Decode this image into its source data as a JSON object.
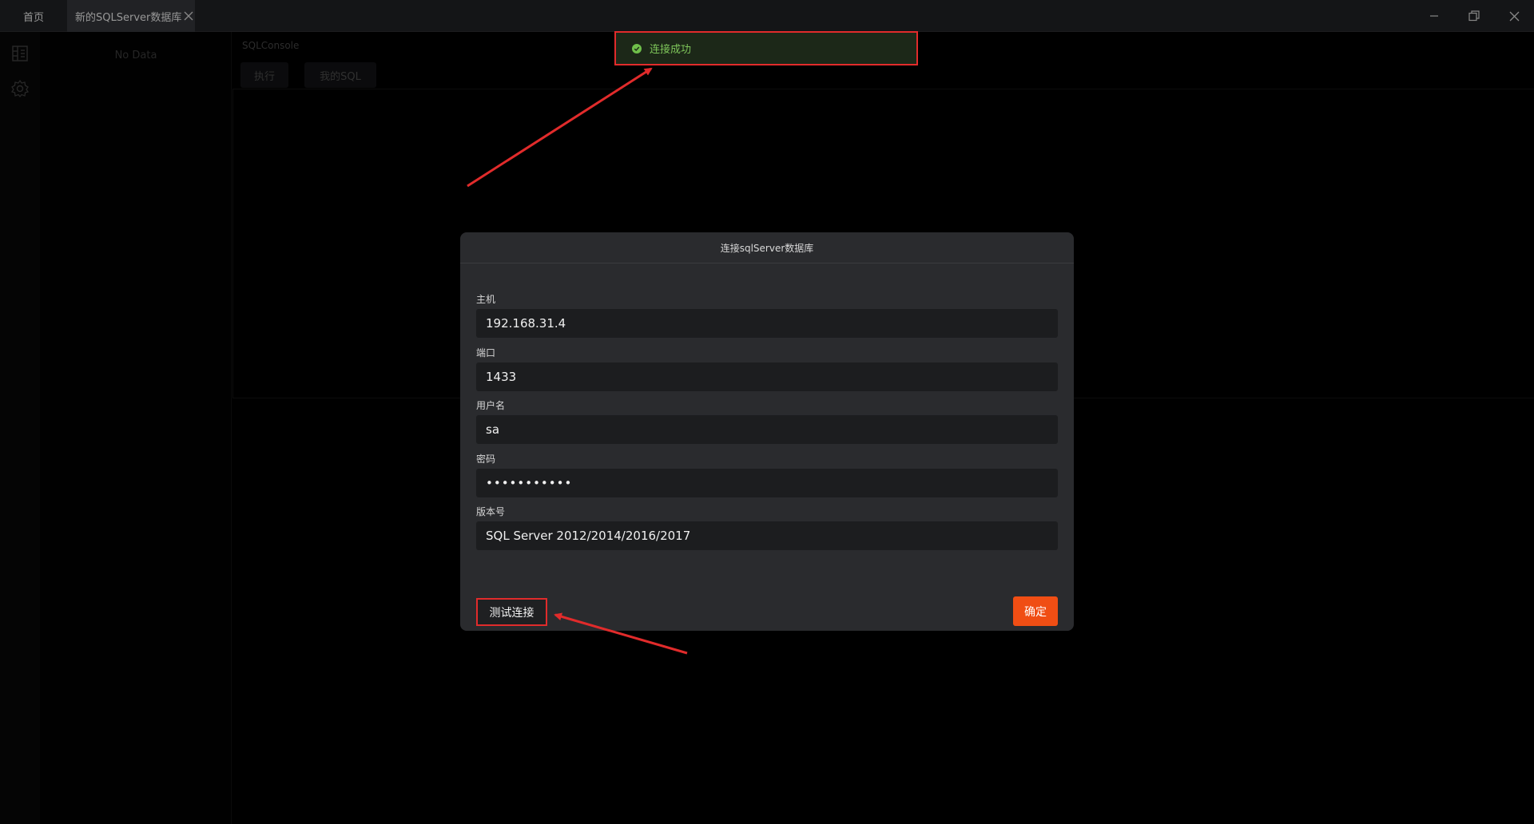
{
  "titlebar": {
    "home_tab": "首页",
    "active_tab": "新的SQLServer数据库"
  },
  "sidebar": {
    "icons": [
      "database-icon",
      "settings-icon"
    ]
  },
  "tree": {
    "empty_text": "No Data"
  },
  "console": {
    "title": "SQLConsole",
    "execute_label": "执行",
    "my_sql_label": "我的SQL"
  },
  "toast": {
    "message": "连接成功",
    "color": "#7ec55a"
  },
  "dialog": {
    "title": "连接sqlServer数据库",
    "fields": {
      "host": {
        "label": "主机",
        "value": "192.168.31.4"
      },
      "port": {
        "label": "端口",
        "value": "1433"
      },
      "username": {
        "label": "用户名",
        "value": "sa"
      },
      "password": {
        "label": "密码",
        "value": "•••••••••••"
      },
      "version": {
        "label": "版本号",
        "value": "SQL Server 2012/2014/2016/2017"
      }
    },
    "test_button": "测试连接",
    "ok_button": "确定",
    "accent_color": "#f04e14"
  },
  "annotation_color": "#e12b2b"
}
